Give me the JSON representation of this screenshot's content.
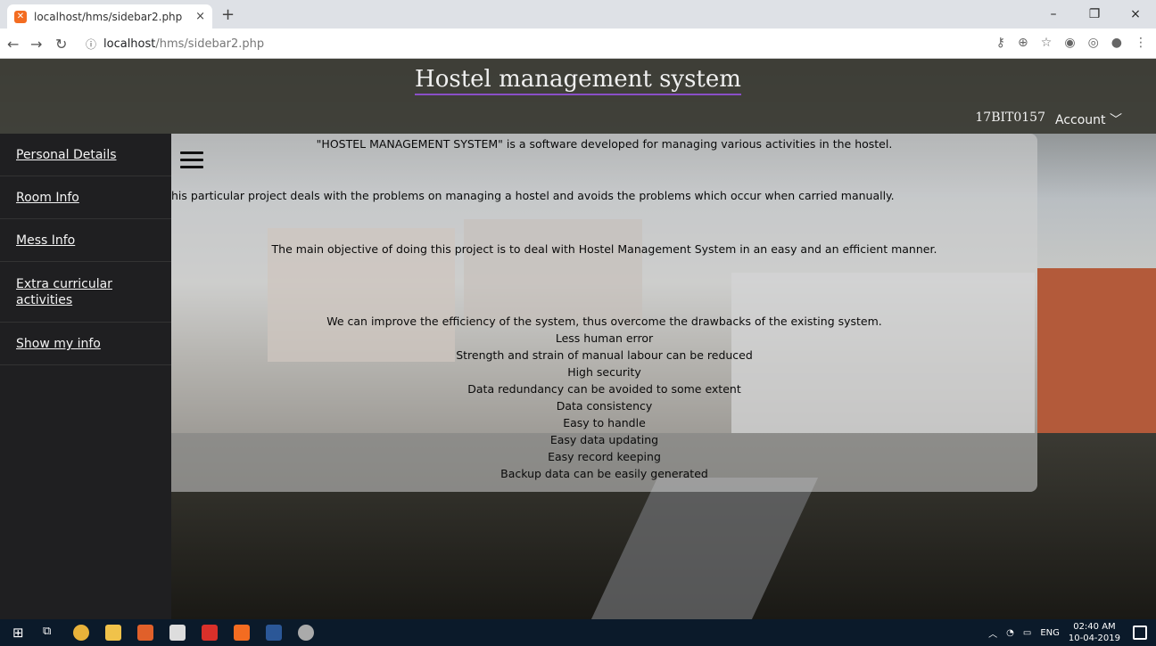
{
  "browser": {
    "tab_title": "localhost/hms/sidebar2.php",
    "tab_close": "×",
    "new_tab": "+",
    "url_host": "localhost",
    "url_path": "/hms/sidebar2.php",
    "window_controls": [
      "–",
      "❐",
      "×"
    ]
  },
  "header": {
    "title": "Hostel management system",
    "user_id": "17BIT0157",
    "account_label": "Account"
  },
  "sidebar": {
    "items": [
      {
        "label": "Personal Details"
      },
      {
        "label": "Room Info"
      },
      {
        "label": "Mess Info"
      },
      {
        "label": "Extra curricular activities"
      },
      {
        "label": "Show my info"
      }
    ]
  },
  "content": {
    "intro": "\"HOSTEL MANAGEMENT SYSTEM\" is a software developed for managing various activities in the hostel.",
    "problem": "his particular project deals with the problems on managing a hostel and avoids the problems which occur when carried manually.",
    "objective": "The main objective of doing this project is to deal with Hostel Management System in an easy and an efficient manner.",
    "improve": "We can improve the efficiency of the system, thus overcome the drawbacks of the existing system.",
    "benefits": [
      "Less human error",
      "Strength and strain of manual labour can be reduced",
      "High security",
      "Data redundancy can be avoided to some extent",
      "Data consistency",
      "Easy to handle",
      "Easy data updating",
      "Easy record keeping",
      "Backup data can be easily generated"
    ]
  },
  "taskbar": {
    "language": "ENG",
    "time": "02:40 AM",
    "date": "10-04-2019"
  }
}
